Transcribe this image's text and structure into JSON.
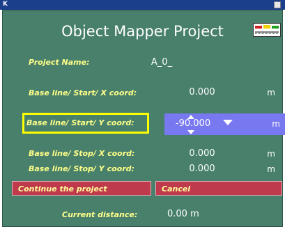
{
  "app": {
    "title_letter": "K"
  },
  "dialog": {
    "title": "Object Mapper Project",
    "fields": [
      {
        "label": "Project Name:",
        "value": "A_0_",
        "unit": ""
      },
      {
        "label": "Base line/ Start/ X coord:",
        "value": "0.000",
        "unit": "m"
      },
      {
        "label": "Base line/ Start/ Y coord:",
        "value": "-90.000",
        "unit": "m"
      },
      {
        "label": "Base line/ Stop/ X coord:",
        "value": "0.000",
        "unit": "m"
      },
      {
        "label": "Base line/ Stop/ Y coord:",
        "value": "0.000",
        "unit": "m"
      }
    ],
    "continue_label": "Continue the project",
    "cancel_label": "Cancel",
    "distance_label": "Current distance:",
    "distance_value": "0.00 m"
  },
  "colors": {
    "panel": "#48806c",
    "label": "#ffff88",
    "highlight": "#ffff00",
    "active_field": "#7878f0",
    "button": "#c03a4e"
  },
  "icons": [
    "signal-gauge-icon",
    "spin-up-icon",
    "spin-down-icon",
    "dropdown-arrow-icon"
  ]
}
